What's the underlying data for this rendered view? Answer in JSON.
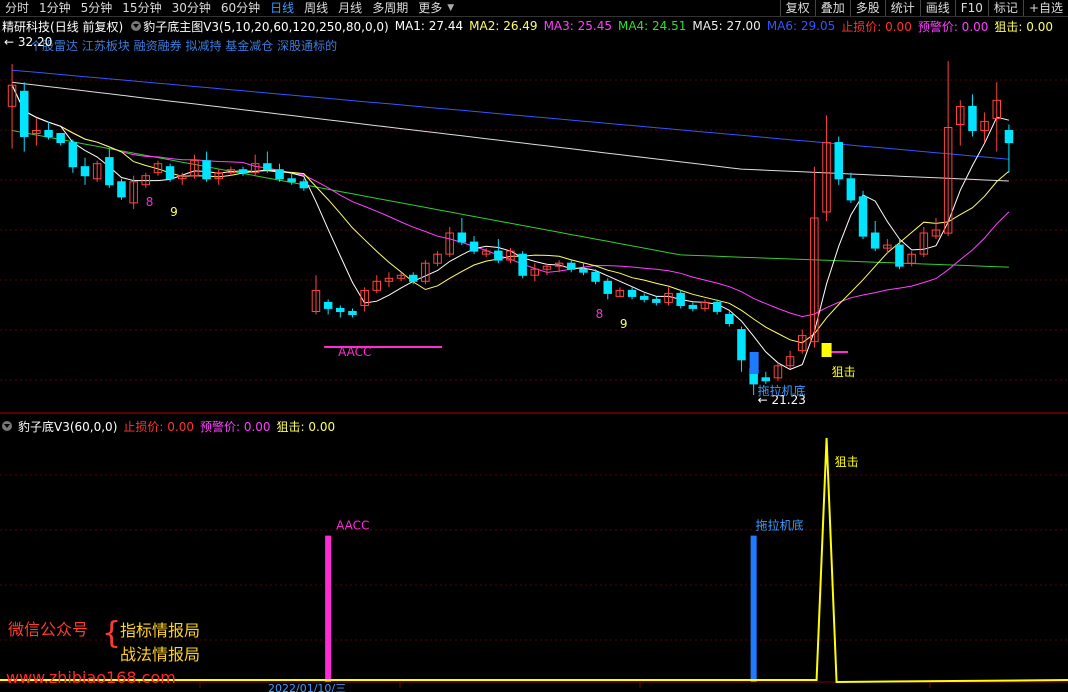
{
  "toolbar": {
    "items": [
      "分时",
      "1分钟",
      "5分钟",
      "15分钟",
      "30分钟",
      "60分钟",
      "日线",
      "周线",
      "月线",
      "多周期",
      "更多"
    ],
    "active_index": 6,
    "right_buttons": [
      "复权",
      "叠加",
      "多股",
      "统计",
      "画线",
      "F10",
      "标记",
      "+自选"
    ]
  },
  "infobar": {
    "stock": "精研科技",
    "period": "(日线 前复权)",
    "indicator": "豹子底主图V3(5,10,20,60,120,250,80,0,0)",
    "ma1": "MA1: 27.44",
    "ma2": "MA2: 26.49",
    "ma3": "MA3: 25.45",
    "ma4": "MA4: 24.51",
    "ma5": "MA5: 27.00",
    "ma6": "MA6: 29.05",
    "stop": "止损价: 0.00",
    "warn": "预警价: 0.00",
    "block": "狙击: 0.00"
  },
  "tags": [
    "个股雷达 江苏板块 融资融券 拟减持 基金减仓 深股通标的"
  ],
  "chart_labels": {
    "high": "32.20",
    "low": "21.23",
    "aacc": "AACC",
    "tuola": "拖拉机底",
    "juji": "狙击",
    "n8a": "8",
    "n9a": "9",
    "n8b": "8",
    "n9b": "9"
  },
  "indicator_bar": {
    "name": "豹子底V3(60,0,0)",
    "stop": "止损价: 0.00",
    "warn": "预警价: 0.00",
    "block": "狙击: 0.00"
  },
  "lower_labels": {
    "aacc": "AACC",
    "tuola": "拖拉机底",
    "juji": "狙击"
  },
  "watermark": {
    "left": "微信公众号",
    "brace": "{",
    "line1": "指标情报局",
    "line2": "战法情报局",
    "url": "www.zhibiao168.com"
  },
  "axis_dates": [
    "2022/01/10/三"
  ],
  "colors": {
    "up": "#ff4444",
    "down": "#00e5ff",
    "ma1": "#ffffff",
    "ma2": "#ffff66",
    "ma3": "#ff40ff",
    "ma4": "#33cc33",
    "ma5": "#dddddd",
    "ma6": "#3355ff",
    "aacc": "#ff2bd4",
    "tuola": "#1e7bff",
    "juji": "#ffff00"
  },
  "chart_data": {
    "type": "candlestick",
    "candles": [
      {
        "o": 30.8,
        "h": 32.2,
        "l": 29.4,
        "c": 31.5
      },
      {
        "o": 31.3,
        "h": 31.6,
        "l": 29.3,
        "c": 29.8
      },
      {
        "o": 29.9,
        "h": 30.4,
        "l": 29.5,
        "c": 30.0
      },
      {
        "o": 30.0,
        "h": 30.3,
        "l": 29.7,
        "c": 29.8
      },
      {
        "o": 29.9,
        "h": 29.9,
        "l": 29.5,
        "c": 29.6
      },
      {
        "o": 29.6,
        "h": 29.7,
        "l": 28.6,
        "c": 28.8
      },
      {
        "o": 28.8,
        "h": 29.1,
        "l": 28.2,
        "c": 28.5
      },
      {
        "o": 28.4,
        "h": 29.0,
        "l": 28.3,
        "c": 28.9
      },
      {
        "o": 29.1,
        "h": 29.4,
        "l": 28.1,
        "c": 28.2
      },
      {
        "o": 28.3,
        "h": 28.4,
        "l": 27.7,
        "c": 27.8
      },
      {
        "o": 27.6,
        "h": 28.5,
        "l": 27.4,
        "c": 28.3
      },
      {
        "o": 28.2,
        "h": 28.6,
        "l": 28.1,
        "c": 28.5
      },
      {
        "o": 28.6,
        "h": 29.0,
        "l": 28.5,
        "c": 28.9
      },
      {
        "o": 28.8,
        "h": 28.9,
        "l": 28.3,
        "c": 28.4
      },
      {
        "o": 28.4,
        "h": 28.6,
        "l": 28.2,
        "c": 28.5
      },
      {
        "o": 28.5,
        "h": 29.2,
        "l": 28.4,
        "c": 29.0
      },
      {
        "o": 29.0,
        "h": 29.3,
        "l": 28.3,
        "c": 28.4
      },
      {
        "o": 28.4,
        "h": 28.7,
        "l": 28.2,
        "c": 28.6
      },
      {
        "o": 28.6,
        "h": 28.8,
        "l": 28.5,
        "c": 28.7
      },
      {
        "o": 28.7,
        "h": 28.8,
        "l": 28.5,
        "c": 28.6
      },
      {
        "o": 28.6,
        "h": 29.2,
        "l": 28.5,
        "c": 28.9
      },
      {
        "o": 28.9,
        "h": 29.3,
        "l": 28.6,
        "c": 28.7
      },
      {
        "o": 28.7,
        "h": 28.9,
        "l": 28.3,
        "c": 28.4
      },
      {
        "o": 28.4,
        "h": 28.6,
        "l": 28.2,
        "c": 28.3
      },
      {
        "o": 28.3,
        "h": 28.4,
        "l": 28.0,
        "c": 28.1
      },
      {
        "o": 24.0,
        "h": 25.2,
        "l": 23.9,
        "c": 24.7
      },
      {
        "o": 24.3,
        "h": 24.4,
        "l": 23.9,
        "c": 24.1
      },
      {
        "o": 24.1,
        "h": 24.2,
        "l": 23.8,
        "c": 24.0
      },
      {
        "o": 24.0,
        "h": 24.1,
        "l": 23.8,
        "c": 23.9
      },
      {
        "o": 24.2,
        "h": 24.8,
        "l": 24.0,
        "c": 24.7
      },
      {
        "o": 24.7,
        "h": 25.2,
        "l": 24.6,
        "c": 25.0
      },
      {
        "o": 25.0,
        "h": 25.3,
        "l": 24.8,
        "c": 25.1
      },
      {
        "o": 25.1,
        "h": 25.3,
        "l": 25.0,
        "c": 25.2
      },
      {
        "o": 25.2,
        "h": 25.3,
        "l": 24.9,
        "c": 25.0
      },
      {
        "o": 25.0,
        "h": 25.7,
        "l": 24.9,
        "c": 25.6
      },
      {
        "o": 25.6,
        "h": 26.0,
        "l": 25.5,
        "c": 25.9
      },
      {
        "o": 25.9,
        "h": 26.8,
        "l": 25.8,
        "c": 26.6
      },
      {
        "o": 26.6,
        "h": 27.1,
        "l": 26.2,
        "c": 26.3
      },
      {
        "o": 26.3,
        "h": 26.5,
        "l": 25.9,
        "c": 26.0
      },
      {
        "o": 25.9,
        "h": 26.1,
        "l": 25.8,
        "c": 26.0
      },
      {
        "o": 26.0,
        "h": 26.4,
        "l": 25.6,
        "c": 25.7
      },
      {
        "o": 25.7,
        "h": 26.1,
        "l": 25.6,
        "c": 26.0
      },
      {
        "o": 25.9,
        "h": 26.0,
        "l": 25.1,
        "c": 25.2
      },
      {
        "o": 25.2,
        "h": 25.6,
        "l": 25.0,
        "c": 25.4
      },
      {
        "o": 25.4,
        "h": 25.6,
        "l": 25.2,
        "c": 25.5
      },
      {
        "o": 25.5,
        "h": 25.7,
        "l": 25.3,
        "c": 25.6
      },
      {
        "o": 25.6,
        "h": 25.7,
        "l": 25.3,
        "c": 25.4
      },
      {
        "o": 25.4,
        "h": 25.6,
        "l": 25.2,
        "c": 25.3
      },
      {
        "o": 25.3,
        "h": 25.4,
        "l": 24.9,
        "c": 25.0
      },
      {
        "o": 25.0,
        "h": 25.1,
        "l": 24.4,
        "c": 24.6
      },
      {
        "o": 24.5,
        "h": 24.8,
        "l": 24.5,
        "c": 24.7
      },
      {
        "o": 24.7,
        "h": 24.8,
        "l": 24.4,
        "c": 24.5
      },
      {
        "o": 24.5,
        "h": 24.6,
        "l": 24.3,
        "c": 24.4
      },
      {
        "o": 24.4,
        "h": 24.5,
        "l": 24.2,
        "c": 24.3
      },
      {
        "o": 24.3,
        "h": 24.8,
        "l": 24.2,
        "c": 24.6
      },
      {
        "o": 24.6,
        "h": 24.7,
        "l": 24.1,
        "c": 24.2
      },
      {
        "o": 24.2,
        "h": 24.3,
        "l": 24.0,
        "c": 24.1
      },
      {
        "o": 24.1,
        "h": 24.4,
        "l": 24.0,
        "c": 24.3
      },
      {
        "o": 24.3,
        "h": 24.4,
        "l": 23.9,
        "c": 24.0
      },
      {
        "o": 23.9,
        "h": 24.0,
        "l": 23.5,
        "c": 23.6
      },
      {
        "o": 23.4,
        "h": 23.5,
        "l": 22.0,
        "c": 22.4
      },
      {
        "o": 22.1,
        "h": 22.2,
        "l": 21.23,
        "c": 21.6
      },
      {
        "o": 21.8,
        "h": 22.0,
        "l": 21.6,
        "c": 21.7
      },
      {
        "o": 21.8,
        "h": 22.3,
        "l": 21.7,
        "c": 22.2
      },
      {
        "o": 22.2,
        "h": 22.7,
        "l": 22.1,
        "c": 22.5
      },
      {
        "o": 22.7,
        "h": 23.4,
        "l": 22.6,
        "c": 23.2
      },
      {
        "o": 23.0,
        "h": 28.8,
        "l": 22.8,
        "c": 27.1
      },
      {
        "o": 27.3,
        "h": 30.5,
        "l": 27.0,
        "c": 29.6
      },
      {
        "o": 29.6,
        "h": 29.8,
        "l": 28.2,
        "c": 28.4
      },
      {
        "o": 28.4,
        "h": 28.6,
        "l": 27.6,
        "c": 27.7
      },
      {
        "o": 27.8,
        "h": 28.0,
        "l": 26.4,
        "c": 26.5
      },
      {
        "o": 26.6,
        "h": 27.0,
        "l": 26.0,
        "c": 26.1
      },
      {
        "o": 26.1,
        "h": 26.4,
        "l": 25.9,
        "c": 26.2
      },
      {
        "o": 26.2,
        "h": 26.4,
        "l": 25.4,
        "c": 25.5
      },
      {
        "o": 25.6,
        "h": 26.0,
        "l": 25.5,
        "c": 25.9
      },
      {
        "o": 25.9,
        "h": 26.8,
        "l": 25.8,
        "c": 26.6
      },
      {
        "o": 26.5,
        "h": 27.1,
        "l": 26.4,
        "c": 26.7
      },
      {
        "o": 26.6,
        "h": 32.3,
        "l": 26.5,
        "c": 30.1
      },
      {
        "o": 30.2,
        "h": 31.0,
        "l": 29.5,
        "c": 30.8
      },
      {
        "o": 30.8,
        "h": 31.2,
        "l": 29.8,
        "c": 30.0
      },
      {
        "o": 30.0,
        "h": 30.6,
        "l": 29.6,
        "c": 30.3
      },
      {
        "o": 30.4,
        "h": 31.6,
        "l": 29.3,
        "c": 31.0
      },
      {
        "o": 30.0,
        "h": 30.2,
        "l": 28.6,
        "c": 29.6
      }
    ],
    "ylim": [
      20.8,
      33.0
    ],
    "lower_series": {
      "aacc_index": 26,
      "tuola_index": 61,
      "juji_index": 67,
      "aacc_value": 0.6,
      "tuola_value": 0.6,
      "juji_value": 1.0
    }
  }
}
